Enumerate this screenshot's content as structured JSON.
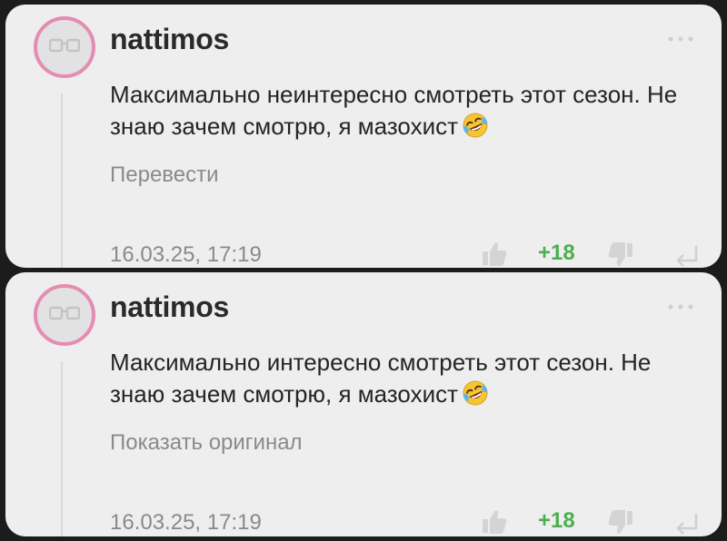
{
  "comments": [
    {
      "username": "nattimos",
      "text": "Максимально неинтересно смотреть этот сезон. Не знаю зачем смотрю, я мазохист",
      "emoji": "rolling-on-floor-laughing",
      "action_label": "Перевести",
      "timestamp": "16.03.25, 17:19",
      "score": "+18"
    },
    {
      "username": "nattimos",
      "text": "Максимально интересно смотреть этот сезон. Не знаю зачем смотрю, я мазохист",
      "emoji": "rolling-on-floor-laughing",
      "action_label": "Показать оригинал",
      "timestamp": "16.03.25, 17:19",
      "score": "+18"
    }
  ],
  "colors": {
    "card_bg": "#eeeeee",
    "avatar_ring": "#e58cb2",
    "score_positive": "#4caf50",
    "muted_text": "#8a8a8a"
  }
}
